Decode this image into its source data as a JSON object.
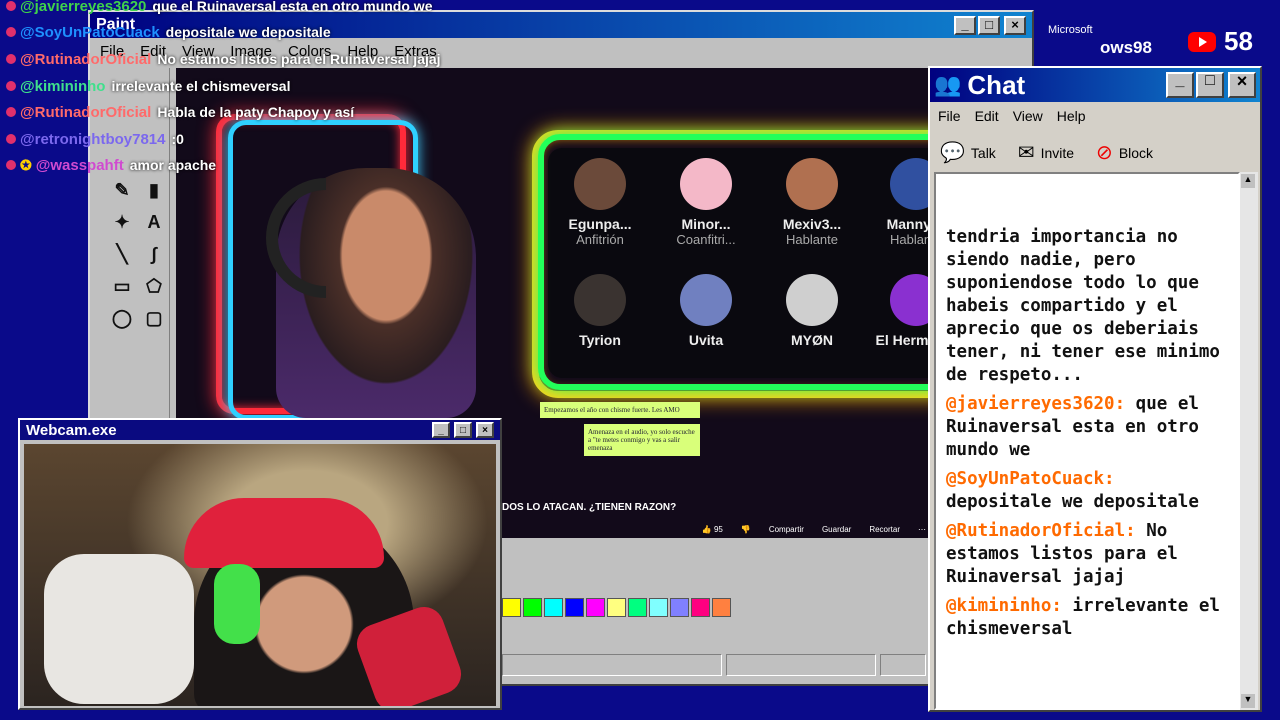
{
  "overlay_chat": [
    {
      "user": "@javierreyes3620",
      "color": "#3fd24b",
      "message": "que el Ruinaversal esta en otro mundo we"
    },
    {
      "user": "@SoyUnPatoCuack",
      "color": "#1e90ff",
      "message": "depositale we depositale"
    },
    {
      "user": "@RutinadorOficial",
      "color": "#ff6a6a",
      "message": "No estamos listos para el Ruinaversal jajaj"
    },
    {
      "user": "@kimininho",
      "color": "#3fe08c",
      "message": "irrelevante el chismeversal"
    },
    {
      "user": "@RutinadorOficial",
      "color": "#ff6a6a",
      "message": "Habla de la paty Chapoy y así"
    },
    {
      "user": "@retronightboy7814",
      "color": "#7b68ee",
      "message": ":0"
    },
    {
      "user": "@wasspahft",
      "color": "#d04ad0",
      "message": "amor apache"
    }
  ],
  "paint": {
    "title": "Paint",
    "menu": [
      "File",
      "Edit",
      "View",
      "Image",
      "Colors",
      "Help",
      "Extras"
    ],
    "palette": [
      "#ffff00",
      "#00ff00",
      "#00ffff",
      "#0000ff",
      "#ff00ff",
      "#ffff80",
      "#00ff80",
      "#80ffff",
      "#8080ff",
      "#ff0080",
      "#ff8040"
    ]
  },
  "spaces": {
    "participants": [
      {
        "name": "Egunpa...",
        "role": "Anfitrión",
        "color": "#6b4a3a"
      },
      {
        "name": "Minor...",
        "role": "Coanfitri...",
        "color": "#f4b8c8"
      },
      {
        "name": "Mexiv3...",
        "role": "Hablante",
        "color": "#b07050"
      },
      {
        "name": "Manny....",
        "role": "Hablante",
        "color": "#3050a0"
      },
      {
        "name": "Tyrion",
        "role": "",
        "color": "#3a3330"
      },
      {
        "name": "Uvita",
        "role": "",
        "color": "#7080c0"
      },
      {
        "name": "MYØN",
        "role": "",
        "color": "#cfcfcf"
      },
      {
        "name": "El Herman...",
        "role": "",
        "color": "#8a30d0"
      }
    ],
    "notes": [
      "Empezamos el año con chisme fuerte. Les AMO",
      "Amenaza en el audio, yo solo escuche a \"te metes conmigo y vas a salir emenaza"
    ],
    "video_title": "DOS LO ATACAN. ¿TIENEN RAZON?",
    "actions": {
      "likes": "95",
      "share": "Compartir",
      "save": "Guardar",
      "clip": "Recortar"
    }
  },
  "webcam": {
    "title": "Webcam.exe"
  },
  "chat": {
    "title": "Chat",
    "menu": [
      "File",
      "Edit",
      "View",
      "Help"
    ],
    "tools": {
      "talk": "Talk",
      "invite": "Invite",
      "block": "Block"
    },
    "first_text": "tendria importancia no siendo nadie, pero suponiendose todo lo que habeis compartido y el aprecio que os deberiais tener, ni tener ese minimo de respeto...",
    "messages": [
      {
        "user": "@javierreyes3620:",
        "text": "que el Ruinaversal esta en otro mundo we"
      },
      {
        "user": "@SoyUnPatoCuack:",
        "text": "depositale we depositale"
      },
      {
        "user": "@RutinadorOficial:",
        "text": "No estamos listos para el Ruinaversal jajaj"
      },
      {
        "user": "@kimininho:",
        "text": "irrelevante el chismeversal"
      }
    ]
  },
  "badges": {
    "microsoft": "Microsoft",
    "windows": "ows98",
    "viewers": "58"
  }
}
